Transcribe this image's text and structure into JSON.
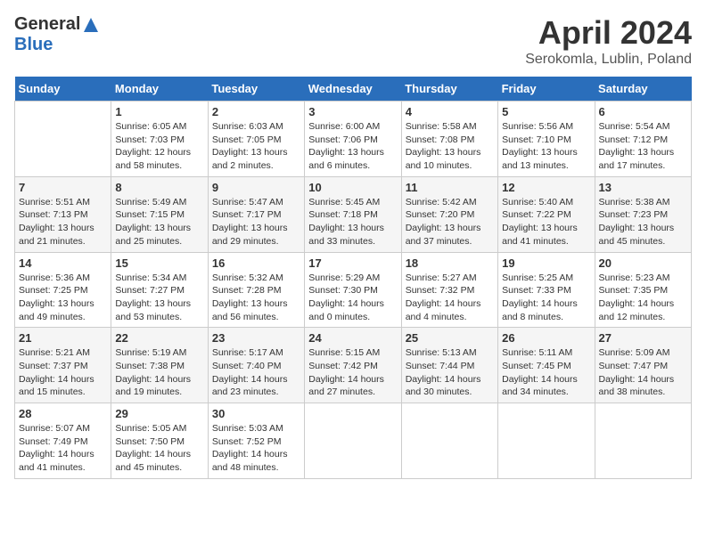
{
  "header": {
    "logo_general": "General",
    "logo_blue": "Blue",
    "title": "April 2024",
    "subtitle": "Serokomla, Lublin, Poland"
  },
  "days_of_week": [
    "Sunday",
    "Monday",
    "Tuesday",
    "Wednesday",
    "Thursday",
    "Friday",
    "Saturday"
  ],
  "weeks": [
    [
      {
        "day": "",
        "info": ""
      },
      {
        "day": "1",
        "info": "Sunrise: 6:05 AM\nSunset: 7:03 PM\nDaylight: 12 hours\nand 58 minutes."
      },
      {
        "day": "2",
        "info": "Sunrise: 6:03 AM\nSunset: 7:05 PM\nDaylight: 13 hours\nand 2 minutes."
      },
      {
        "day": "3",
        "info": "Sunrise: 6:00 AM\nSunset: 7:06 PM\nDaylight: 13 hours\nand 6 minutes."
      },
      {
        "day": "4",
        "info": "Sunrise: 5:58 AM\nSunset: 7:08 PM\nDaylight: 13 hours\nand 10 minutes."
      },
      {
        "day": "5",
        "info": "Sunrise: 5:56 AM\nSunset: 7:10 PM\nDaylight: 13 hours\nand 13 minutes."
      },
      {
        "day": "6",
        "info": "Sunrise: 5:54 AM\nSunset: 7:12 PM\nDaylight: 13 hours\nand 17 minutes."
      }
    ],
    [
      {
        "day": "7",
        "info": "Sunrise: 5:51 AM\nSunset: 7:13 PM\nDaylight: 13 hours\nand 21 minutes."
      },
      {
        "day": "8",
        "info": "Sunrise: 5:49 AM\nSunset: 7:15 PM\nDaylight: 13 hours\nand 25 minutes."
      },
      {
        "day": "9",
        "info": "Sunrise: 5:47 AM\nSunset: 7:17 PM\nDaylight: 13 hours\nand 29 minutes."
      },
      {
        "day": "10",
        "info": "Sunrise: 5:45 AM\nSunset: 7:18 PM\nDaylight: 13 hours\nand 33 minutes."
      },
      {
        "day": "11",
        "info": "Sunrise: 5:42 AM\nSunset: 7:20 PM\nDaylight: 13 hours\nand 37 minutes."
      },
      {
        "day": "12",
        "info": "Sunrise: 5:40 AM\nSunset: 7:22 PM\nDaylight: 13 hours\nand 41 minutes."
      },
      {
        "day": "13",
        "info": "Sunrise: 5:38 AM\nSunset: 7:23 PM\nDaylight: 13 hours\nand 45 minutes."
      }
    ],
    [
      {
        "day": "14",
        "info": "Sunrise: 5:36 AM\nSunset: 7:25 PM\nDaylight: 13 hours\nand 49 minutes."
      },
      {
        "day": "15",
        "info": "Sunrise: 5:34 AM\nSunset: 7:27 PM\nDaylight: 13 hours\nand 53 minutes."
      },
      {
        "day": "16",
        "info": "Sunrise: 5:32 AM\nSunset: 7:28 PM\nDaylight: 13 hours\nand 56 minutes."
      },
      {
        "day": "17",
        "info": "Sunrise: 5:29 AM\nSunset: 7:30 PM\nDaylight: 14 hours\nand 0 minutes."
      },
      {
        "day": "18",
        "info": "Sunrise: 5:27 AM\nSunset: 7:32 PM\nDaylight: 14 hours\nand 4 minutes."
      },
      {
        "day": "19",
        "info": "Sunrise: 5:25 AM\nSunset: 7:33 PM\nDaylight: 14 hours\nand 8 minutes."
      },
      {
        "day": "20",
        "info": "Sunrise: 5:23 AM\nSunset: 7:35 PM\nDaylight: 14 hours\nand 12 minutes."
      }
    ],
    [
      {
        "day": "21",
        "info": "Sunrise: 5:21 AM\nSunset: 7:37 PM\nDaylight: 14 hours\nand 15 minutes."
      },
      {
        "day": "22",
        "info": "Sunrise: 5:19 AM\nSunset: 7:38 PM\nDaylight: 14 hours\nand 19 minutes."
      },
      {
        "day": "23",
        "info": "Sunrise: 5:17 AM\nSunset: 7:40 PM\nDaylight: 14 hours\nand 23 minutes."
      },
      {
        "day": "24",
        "info": "Sunrise: 5:15 AM\nSunset: 7:42 PM\nDaylight: 14 hours\nand 27 minutes."
      },
      {
        "day": "25",
        "info": "Sunrise: 5:13 AM\nSunset: 7:44 PM\nDaylight: 14 hours\nand 30 minutes."
      },
      {
        "day": "26",
        "info": "Sunrise: 5:11 AM\nSunset: 7:45 PM\nDaylight: 14 hours\nand 34 minutes."
      },
      {
        "day": "27",
        "info": "Sunrise: 5:09 AM\nSunset: 7:47 PM\nDaylight: 14 hours\nand 38 minutes."
      }
    ],
    [
      {
        "day": "28",
        "info": "Sunrise: 5:07 AM\nSunset: 7:49 PM\nDaylight: 14 hours\nand 41 minutes."
      },
      {
        "day": "29",
        "info": "Sunrise: 5:05 AM\nSunset: 7:50 PM\nDaylight: 14 hours\nand 45 minutes."
      },
      {
        "day": "30",
        "info": "Sunrise: 5:03 AM\nSunset: 7:52 PM\nDaylight: 14 hours\nand 48 minutes."
      },
      {
        "day": "",
        "info": ""
      },
      {
        "day": "",
        "info": ""
      },
      {
        "day": "",
        "info": ""
      },
      {
        "day": "",
        "info": ""
      }
    ]
  ]
}
